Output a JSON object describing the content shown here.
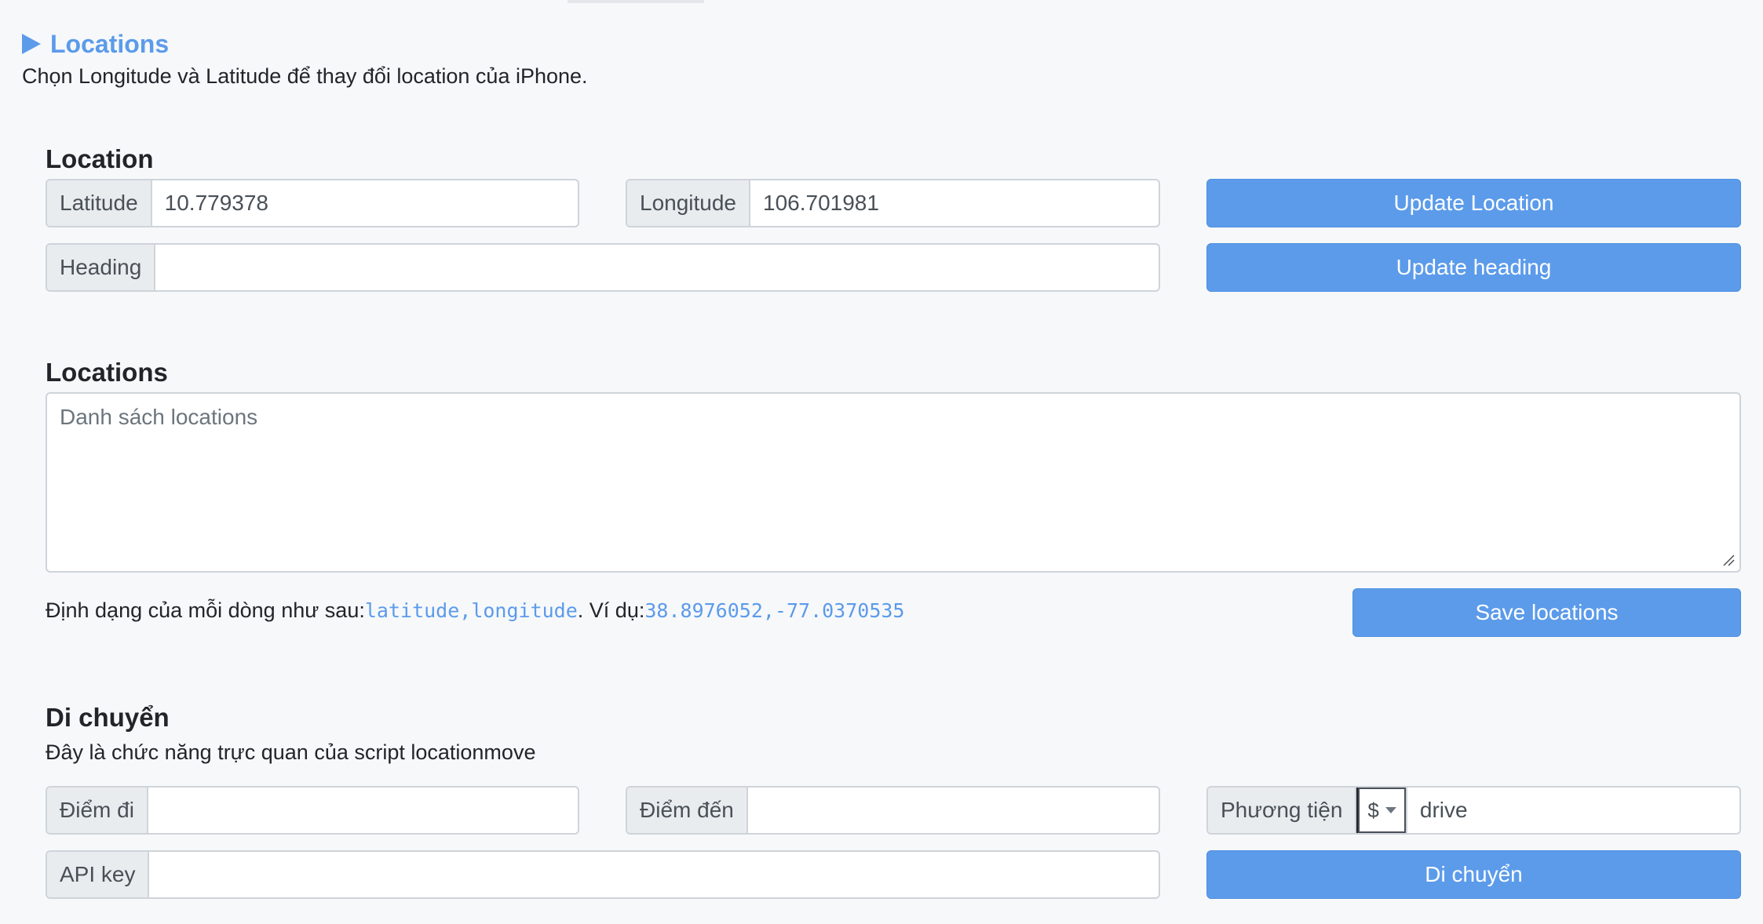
{
  "summary": {
    "title": "Locations"
  },
  "intro": "Chọn Longitude và Latitude để thay đổi location của iPhone.",
  "location": {
    "title": "Location",
    "latitude_label": "Latitude",
    "latitude_value": "10.779378",
    "longitude_label": "Longitude",
    "longitude_value": "106.701981",
    "heading_label": "Heading",
    "heading_value": "",
    "update_location_label": "Update Location",
    "update_heading_label": "Update heading"
  },
  "locations": {
    "title": "Locations",
    "placeholder": "Danh sách locations",
    "format_prefix": "Định dạng của mỗi dòng như sau: ",
    "format_code": "latitude,longitude",
    "example_prefix": ". Ví dụ: ",
    "example_code": "38.8976052,-77.0370535",
    "save_label": "Save locations"
  },
  "move": {
    "title": "Di chuyển",
    "desc": "Đây là chức năng trực quan của script locationmove",
    "from_label": "Điểm đi",
    "from_value": "",
    "to_label": "Điểm đến",
    "to_value": "",
    "vehicle_label": "Phương tiện",
    "vehicle_select": "$",
    "vehicle_value": "drive",
    "api_label": "API key",
    "api_value": "",
    "move_label": "Di chuyển"
  },
  "colors": {
    "accent": "#5b9bea",
    "background": "#f7f8fa",
    "addon": "#e9ecef",
    "border": "#ced4da"
  },
  "icons": {
    "summary": "triangle-right-icon",
    "select": "caret-down-icon",
    "resize": "resize-grip-icon"
  }
}
